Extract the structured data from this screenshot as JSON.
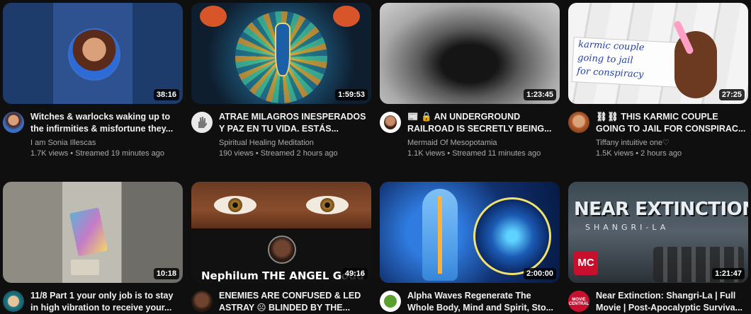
{
  "videos": [
    {
      "title": "Witches & warlocks waking up to the infirmities & misfortune they...",
      "channel": "I am Sonia Illescas",
      "views": "1.7K views",
      "time": "Streamed 19 minutes ago",
      "duration": "38:16"
    },
    {
      "title": "ATRAE MILAGROS INESPERADOS Y PAZ EN TU VIDA. ESTÁS...",
      "channel": "Spiritual Healing Meditation",
      "views": "190 views",
      "time": "Streamed 2 hours ago",
      "duration": "1:59:53"
    },
    {
      "title": "📰 🔒 AN UNDERGROUND RAILROAD IS SECRETLY BEING...",
      "channel": "Mermaid Of Mesopotamia",
      "views": "1.1K views",
      "time": "Streamed 11 minutes ago",
      "duration": "1:23:45"
    },
    {
      "title": "⛓⛓ THIS KARMIC COUPLE GOING TO JAIL FOR CONSPIRAC...",
      "channel": "Tiffany intuitive one♡",
      "views": "1.5K views",
      "time": "2 hours ago",
      "duration": "27:25",
      "thumb_note": [
        "karmic couple",
        "going to jail",
        "for conspiracy"
      ]
    },
    {
      "title": "11/8 Part 1 your only job is to stay in high vibration to receive your...",
      "duration": "10:18"
    },
    {
      "title": "ENEMIES ARE CONFUSED & LED ASTRAY ☹ BLINDED BY THE...",
      "duration": "49:16",
      "thumb_caption": "Nephilum THE ANGEL Godd"
    },
    {
      "title": "Alpha Waves Regenerate The Whole Body, Mind and Spirit, Sto...",
      "duration": "2:00:00"
    },
    {
      "title": "Near Extinction: Shangri-La | Full Movie | Post-Apocalyptic Surviva...",
      "duration": "1:21:47",
      "thumb_title": "NEAR EXTINCTION",
      "thumb_sub": "SHANGRI-LA",
      "thumb_logo": "MC",
      "avatar_text": "MOVIE CENTRAL"
    }
  ],
  "colors": {
    "background": "#0f0f0f",
    "title": "#f1f1f1",
    "meta": "#aaaaaa"
  }
}
